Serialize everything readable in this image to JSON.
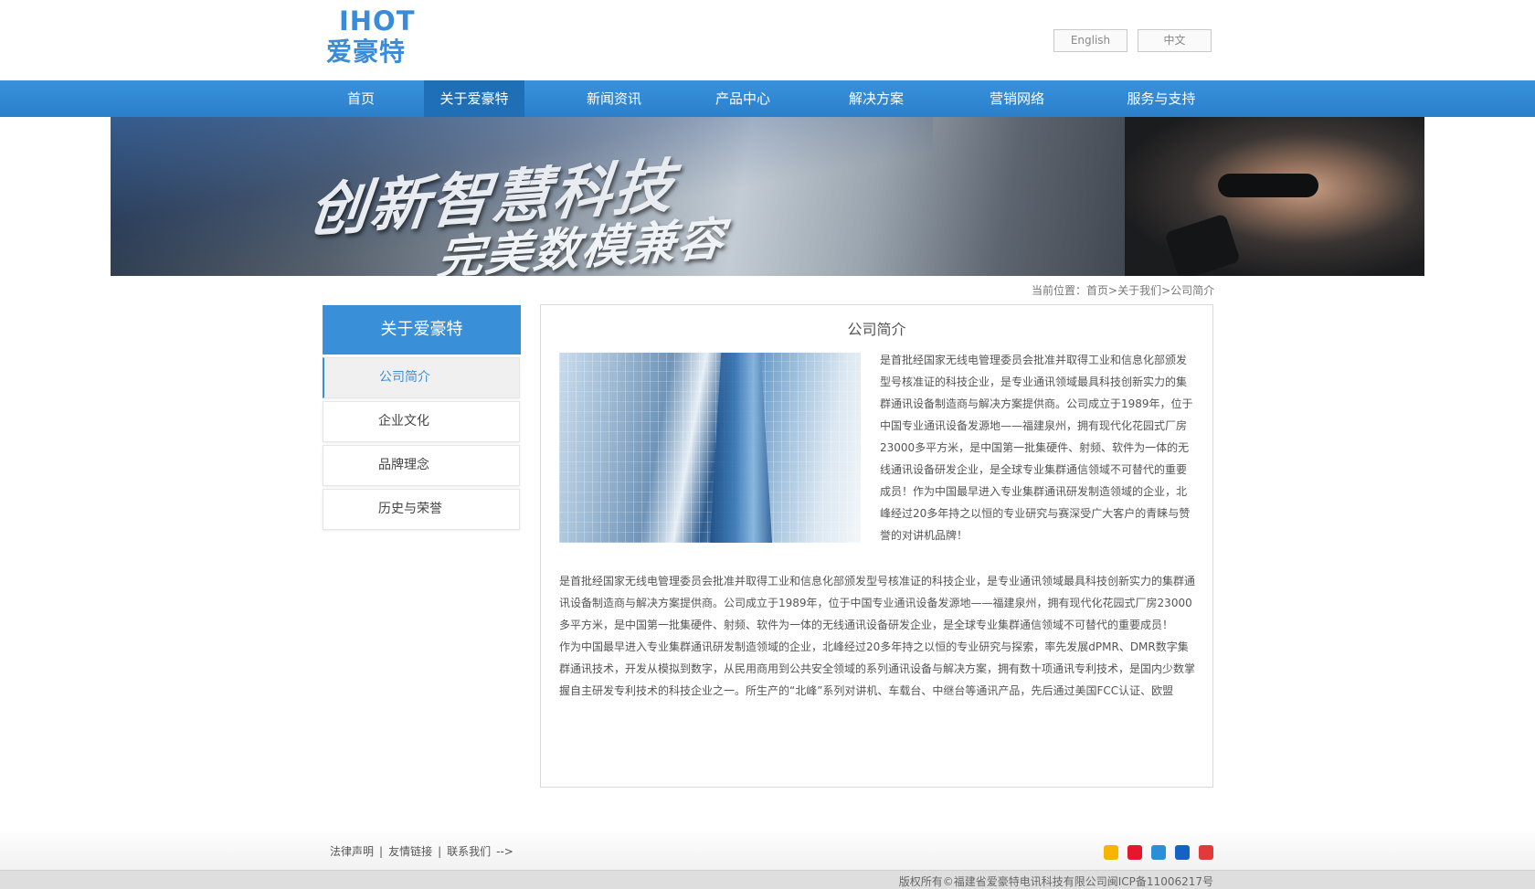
{
  "header": {
    "logo_en": "IHOT",
    "logo_cn": "爱豪特",
    "lang_english": "English",
    "lang_chinese": "中文"
  },
  "nav": {
    "items": [
      {
        "label": "首页"
      },
      {
        "label": "关于爱豪特",
        "active": true
      },
      {
        "label": "新闻资讯"
      },
      {
        "label": "产品中心"
      },
      {
        "label": "解决方案"
      },
      {
        "label": "营销网络"
      },
      {
        "label": "服务与支持"
      }
    ]
  },
  "banner": {
    "line1": "创新智慧科技",
    "line2": "完美数模兼容"
  },
  "breadcrumb": {
    "prefix": "当前位置：",
    "home": "首页",
    "sep1": ">",
    "about": "关于我们",
    "sep2": ">",
    "current": "公司简介"
  },
  "sidebar": {
    "title": "关于爱豪特",
    "items": [
      {
        "label": "公司简介",
        "active": true
      },
      {
        "label": "企业文化"
      },
      {
        "label": "品牌理念"
      },
      {
        "label": "历史与荣誉"
      }
    ]
  },
  "content": {
    "title": "公司简介",
    "intro": "是首批经国家无线电管理委员会批准并取得工业和信息化部颁发型号核准证的科技企业，是专业通讯领域最具科技创新实力的集群通讯设备制造商与解决方案提供商。公司成立于1989年，位于中国专业通讯设备发源地——福建泉州，拥有现代化花园式厂房23000多平方米，是中国第一批集硬件、射频、软件为一体的无线通讯设备研发企业，是全球专业集群通信领域不可替代的重要成员！作为中国最早进入专业集群通讯研发制造领域的企业，北峰经过20多年持之以恒的专业研究与赛深受广大客户的青睐与赞誉的对讲机品牌！",
    "paragraph1": "是首批经国家无线电管理委员会批准并取得工业和信息化部颁发型号核准证的科技企业，是专业通讯领域最具科技创新实力的集群通讯设备制造商与解决方案提供商。公司成立于1989年，位于中国专业通讯设备发源地——福建泉州，拥有现代化花园式厂房23000多平方米，是中国第一批集硬件、射频、软件为一体的无线通讯设备研发企业，是全球专业集群通信领域不可替代的重要成员！",
    "paragraph2": "作为中国最早进入专业集群通讯研发制造领域的企业，北峰经过20多年持之以恒的专业研究与探索，率先发展dPMR、DMR数字集群通讯技术，开发从模拟到数字，从民用商用到公共安全领域的系列通讯设备与解决方案，拥有数十项通讯专利技术，是国内少数掌握自主研发专利技术的科技企业之一。所生产的“北峰”系列对讲机、车载台、中继台等通讯产品，先后通过美国FCC认证、欧盟"
  },
  "footer": {
    "link_legal": "法律声明",
    "link_friends": "友情链接",
    "link_contact": "联系我们",
    "sep": "|",
    "stray": "-->",
    "copyright": "版权所有©福建省爱豪特电讯科技有限公司闽ICP备11006217号"
  },
  "share_icons": [
    {
      "icon": "qzone-icon",
      "color": "#f5b400"
    },
    {
      "icon": "weibo-icon",
      "color": "#e6162d"
    },
    {
      "icon": "pengyou-icon",
      "color": "#2b8fd8"
    },
    {
      "icon": "renren-icon",
      "color": "#1662c3"
    },
    {
      "icon": "qq-weibo-icon",
      "color": "#e23a3a"
    }
  ]
}
